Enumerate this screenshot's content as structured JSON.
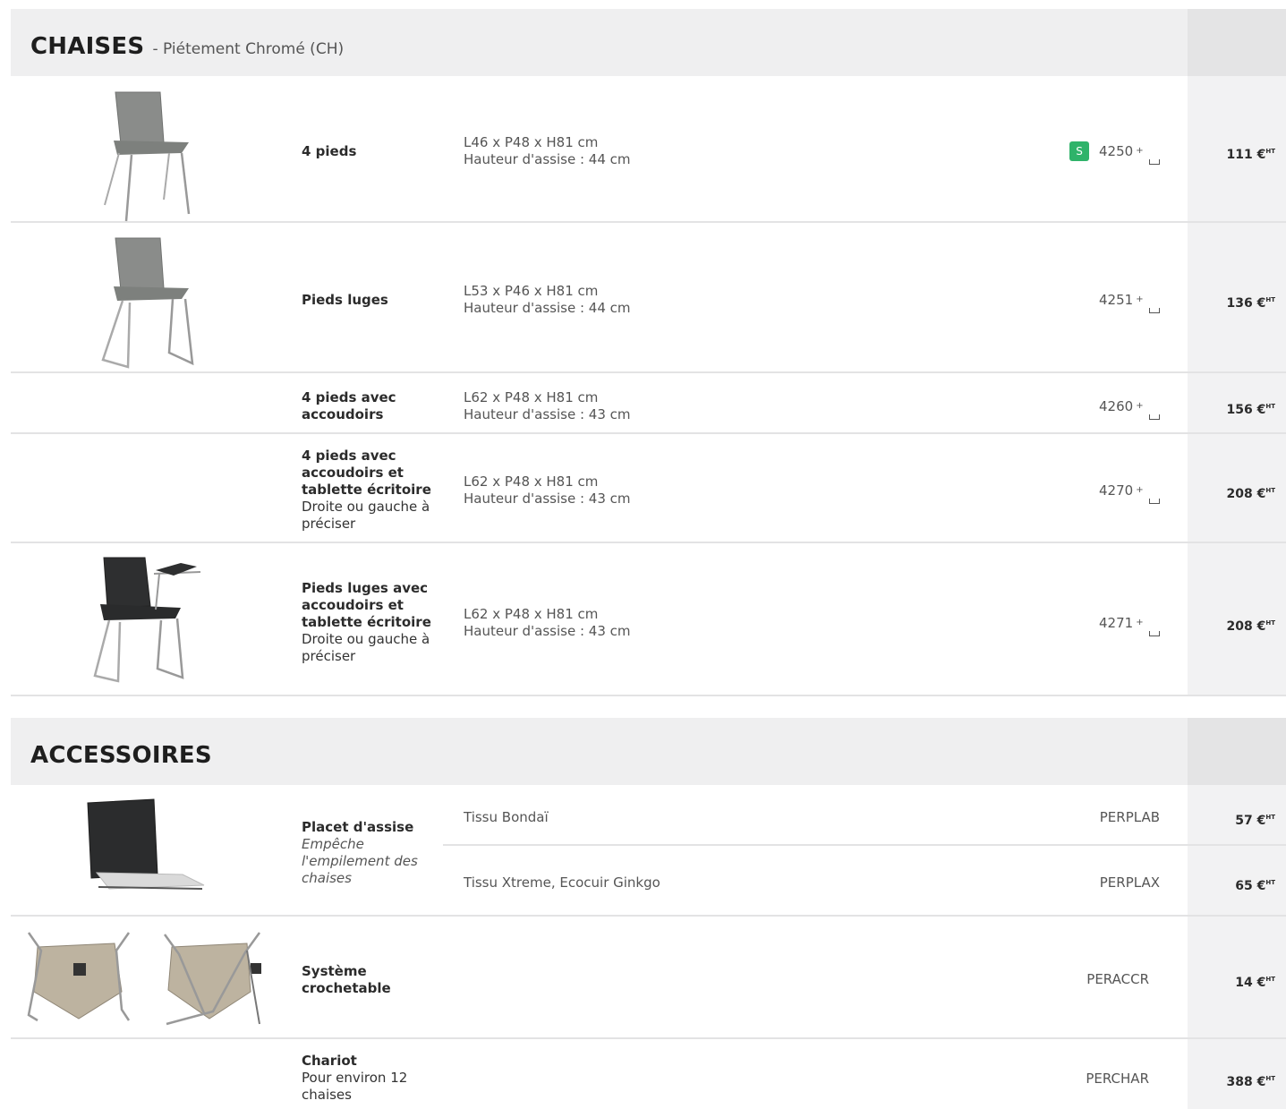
{
  "colors": {
    "header_bg": "#efeff0",
    "price_band": "#e4e4e5",
    "price_col": "#f2f2f3",
    "badge": "#2fb36a"
  },
  "chaises": {
    "title": "CHAISES",
    "subtitle": "- Piétement Chromé (CH)",
    "rows": [
      {
        "name_bold": "4 pieds",
        "dim1": "L46 x P48 x H81 cm",
        "dim2": "Hauteur d'assise : 44 cm",
        "badge": "S",
        "ref": "4250",
        "plus": "+",
        "price": "111 €",
        "unit": "HT"
      },
      {
        "name_bold": "Pieds luges",
        "dim1": "L53 x P46 x H81 cm",
        "dim2": "Hauteur d'assise : 44 cm",
        "ref": "4251",
        "plus": "+",
        "price": "136 €",
        "unit": "HT"
      },
      {
        "name_bold": "4 pieds avec accoudoirs",
        "dim1": "L62 x P48 x H81 cm",
        "dim2": "Hauteur d'assise : 43 cm",
        "ref": "4260",
        "plus": "+",
        "price": "156 €",
        "unit": "HT"
      },
      {
        "name_bold": "4 pieds avec accoudoirs et tablette écritoire",
        "name_sub": "Droite ou gauche à préciser",
        "dim1": "L62 x P48 x H81 cm",
        "dim2": "Hauteur d'assise : 43 cm",
        "ref": "4270",
        "plus": "+",
        "price": "208 €",
        "unit": "HT"
      },
      {
        "name_bold": "Pieds luges avec accoudoirs et tablette écritoire",
        "name_sub": "Droite ou gauche à préciser",
        "dim1": "L62 x P48 x H81 cm",
        "dim2": "Hauteur d'assise : 43 cm",
        "ref": "4271",
        "plus": "+",
        "price": "208 €",
        "unit": "HT"
      }
    ]
  },
  "accessoires": {
    "title": "ACCESSOIRES",
    "placet": {
      "name_bold": "Placet d'assise",
      "name_italic": "Empêche l'empilement des chaises",
      "variants": [
        {
          "label": "Tissu Bondaï",
          "ref": "PERPLAB",
          "price": "57 €",
          "unit": "HT"
        },
        {
          "label": "Tissu Xtreme, Ecocuir Ginkgo",
          "ref": "PERPLAX",
          "price": "65 €",
          "unit": "HT"
        }
      ]
    },
    "systeme": {
      "name_bold": "Système crochetable",
      "ref": "PERACCR",
      "price": "14 €",
      "unit": "HT"
    },
    "chariot": {
      "name_bold": "Chariot",
      "name_sub": "Pour environ 12 chaises",
      "ref": "PERCHAR",
      "price": "388 €",
      "unit": "HT"
    }
  }
}
